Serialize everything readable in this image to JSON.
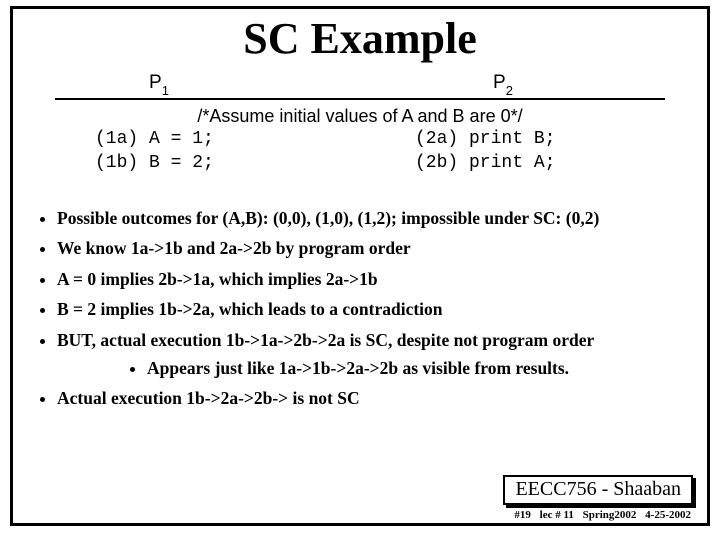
{
  "title": "SC Example",
  "proc": {
    "p1": "P",
    "p1sub": "1",
    "p2": "P",
    "p2sub": "2"
  },
  "assume": "/*Assume initial values of A and B are 0*/",
  "code": {
    "l1": "(1a) A = 1;",
    "l2": "(1b) B = 2;",
    "r1": "(2a) print B;",
    "r2": "(2b) print A;"
  },
  "bullets": {
    "b1": "Possible outcomes for (A,B): (0,0), (1,0), (1,2); impossible under SC: (0,2)",
    "b2": "We know  1a->1b  and  2a->2b by program order",
    "b3": "A = 0 implies  2b->1a, which implies  2a->1b",
    "b4": "B = 2 implies 1b->2a, which leads to a contradiction",
    "b5": "BUT, actual execution 1b->1a->2b->2a is SC, despite not program order",
    "b5a": "Appears just like 1a->1b->2a->2b as visible from results.",
    "b6": "Actual execution 1b->2a->2b-> is not SC"
  },
  "footer": {
    "course": "EECC756 - Shaaban",
    "slide_no": "#19",
    "lec": "lec # 11",
    "term": "Spring2002",
    "date": "4-25-2002"
  }
}
